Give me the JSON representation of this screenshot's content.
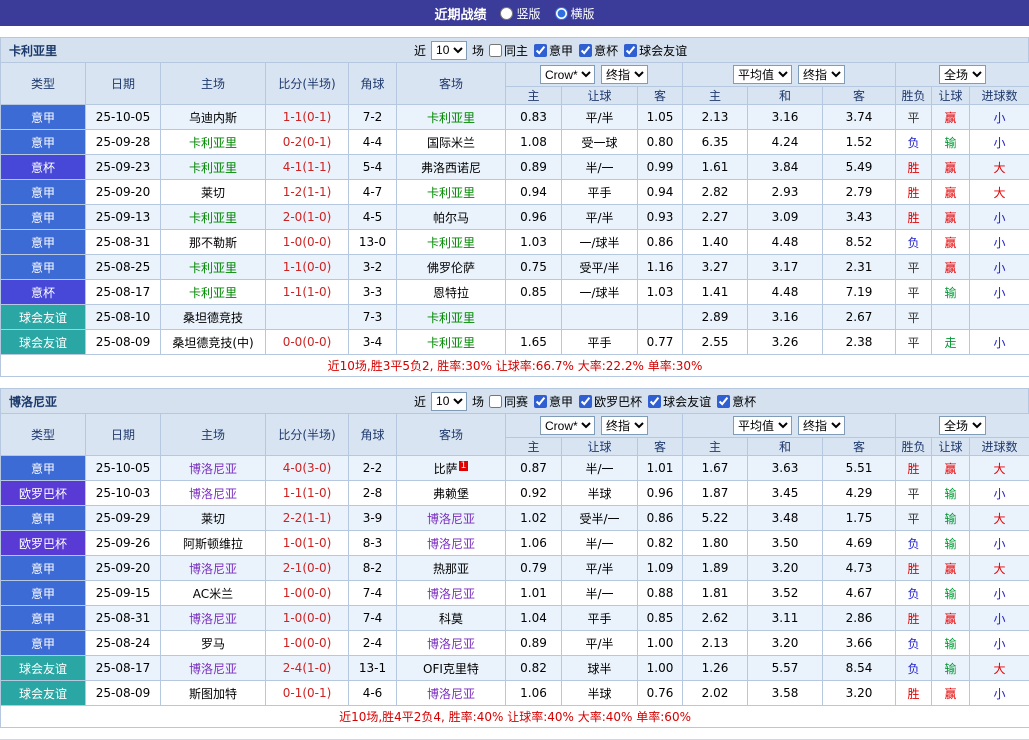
{
  "title_bar": {
    "title": "近期战绩",
    "radios": [
      {
        "label": "竖版",
        "selected": false
      },
      {
        "label": "横版",
        "selected": true
      }
    ]
  },
  "filter_labels": {
    "near": "近",
    "games": "场"
  },
  "columns": {
    "type": "类型",
    "date": "日期",
    "home": "主场",
    "score": "比分(半场)",
    "corner": "角球",
    "away": "客场",
    "asian_home": "主",
    "asian_line": "让球",
    "asian_away": "客",
    "euro_home": "主",
    "euro_draw": "和",
    "euro_away": "客",
    "result": "胜负",
    "handicap_result": "让球",
    "goals": "进球数"
  },
  "header_selects": {
    "odds_source": "Crow*",
    "odds_period": "终指",
    "euro_source": "平均值",
    "euro_period": "终指",
    "scope": "全场"
  },
  "colors": {
    "topbar_bg": "#3b3b99",
    "header_bg": "#d9e4f2",
    "row_alt_bg": "#eaf2fb",
    "score": "#cc2222",
    "summary": "#d40000"
  },
  "league_colors": {
    "意甲": "#3d6bd5",
    "意杯": "#4848d8",
    "球会友谊": "#2aa7a4",
    "欧罗巴杯": "#5a3ad5"
  },
  "result_colors": {
    "胜": "#e60000",
    "平": "#333333",
    "负": "#2222cc"
  },
  "let_colors": {
    "赢": "#e60000",
    "输": "#009933",
    "走": "#009933"
  },
  "goal_colors": {
    "大": "#e60000",
    "小": "#2222cc"
  },
  "sections": [
    {
      "team": "卡利亚里",
      "team_color": "#008800",
      "filter": {
        "count": "10",
        "checkboxes": [
          {
            "label": "同主",
            "checked": false
          },
          {
            "label": "意甲",
            "checked": true
          },
          {
            "label": "意杯",
            "checked": true
          },
          {
            "label": "球会友谊",
            "checked": true
          }
        ]
      },
      "rows": [
        {
          "league": "意甲",
          "date": "25-10-05",
          "home": "乌迪内斯",
          "home_focus": false,
          "score": "1-1(0-1)",
          "corner": "7-2",
          "away": "卡利亚里",
          "away_focus": true,
          "h": "0.83",
          "hcp": "平/半",
          "a": "1.05",
          "eh": "2.13",
          "ed": "3.16",
          "ea": "3.74",
          "res": "平",
          "let": "赢",
          "goal": "小"
        },
        {
          "league": "意甲",
          "date": "25-09-28",
          "home": "卡利亚里",
          "home_focus": true,
          "score": "0-2(0-1)",
          "corner": "4-4",
          "away": "国际米兰",
          "away_focus": false,
          "h": "1.08",
          "hcp": "受一球",
          "a": "0.80",
          "eh": "6.35",
          "ed": "4.24",
          "ea": "1.52",
          "res": "负",
          "let": "输",
          "goal": "小"
        },
        {
          "league": "意杯",
          "date": "25-09-23",
          "home": "卡利亚里",
          "home_focus": true,
          "score": "4-1(1-1)",
          "corner": "5-4",
          "away": "弗洛西诺尼",
          "away_focus": false,
          "h": "0.89",
          "hcp": "半/一",
          "a": "0.99",
          "eh": "1.61",
          "ed": "3.84",
          "ea": "5.49",
          "res": "胜",
          "let": "赢",
          "goal": "大"
        },
        {
          "league": "意甲",
          "date": "25-09-20",
          "home": "莱切",
          "home_focus": false,
          "score": "1-2(1-1)",
          "corner": "4-7",
          "away": "卡利亚里",
          "away_focus": true,
          "h": "0.94",
          "hcp": "平手",
          "a": "0.94",
          "eh": "2.82",
          "ed": "2.93",
          "ea": "2.79",
          "res": "胜",
          "let": "赢",
          "goal": "大"
        },
        {
          "league": "意甲",
          "date": "25-09-13",
          "home": "卡利亚里",
          "home_focus": true,
          "score": "2-0(1-0)",
          "corner": "4-5",
          "away": "帕尔马",
          "away_focus": false,
          "h": "0.96",
          "hcp": "平/半",
          "a": "0.93",
          "eh": "2.27",
          "ed": "3.09",
          "ea": "3.43",
          "res": "胜",
          "let": "赢",
          "goal": "小"
        },
        {
          "league": "意甲",
          "date": "25-08-31",
          "home": "那不勒斯",
          "home_focus": false,
          "score": "1-0(0-0)",
          "corner": "13-0",
          "away": "卡利亚里",
          "away_focus": true,
          "h": "1.03",
          "hcp": "一/球半",
          "a": "0.86",
          "eh": "1.40",
          "ed": "4.48",
          "ea": "8.52",
          "res": "负",
          "let": "赢",
          "goal": "小"
        },
        {
          "league": "意甲",
          "date": "25-08-25",
          "home": "卡利亚里",
          "home_focus": true,
          "score": "1-1(0-0)",
          "corner": "3-2",
          "away": "佛罗伦萨",
          "away_focus": false,
          "h": "0.75",
          "hcp": "受平/半",
          "a": "1.16",
          "eh": "3.27",
          "ed": "3.17",
          "ea": "2.31",
          "res": "平",
          "let": "赢",
          "goal": "小"
        },
        {
          "league": "意杯",
          "date": "25-08-17",
          "home": "卡利亚里",
          "home_focus": true,
          "score": "1-1(1-0)",
          "corner": "3-3",
          "away": "恩特拉",
          "away_focus": false,
          "h": "0.85",
          "hcp": "一/球半",
          "a": "1.03",
          "eh": "1.41",
          "ed": "4.48",
          "ea": "7.19",
          "res": "平",
          "let": "输",
          "goal": "小"
        },
        {
          "league": "球会友谊",
          "date": "25-08-10",
          "home": "桑坦德竞技",
          "home_focus": false,
          "score": "",
          "corner": "7-3",
          "away": "卡利亚里",
          "away_focus": true,
          "h": "",
          "hcp": "",
          "a": "",
          "eh": "2.89",
          "ed": "3.16",
          "ea": "2.67",
          "res": "平",
          "let": "",
          "goal": ""
        },
        {
          "league": "球会友谊",
          "date": "25-08-09",
          "home": "桑坦德竞技(中)",
          "home_focus": false,
          "score": "0-0(0-0)",
          "corner": "3-4",
          "away": "卡利亚里",
          "away_focus": true,
          "h": "1.65",
          "hcp": "平手",
          "a": "0.77",
          "eh": "2.55",
          "ed": "3.26",
          "ea": "2.38",
          "res": "平",
          "let": "走",
          "goal": "小"
        }
      ],
      "summary": "近10场,胜3平5负2, 胜率:30% 让球率:66.7% 大率:22.2% 单率:30%"
    },
    {
      "team": "博洛尼亚",
      "team_color": "#7b2fbe",
      "filter": {
        "count": "10",
        "checkboxes": [
          {
            "label": "同赛",
            "checked": false
          },
          {
            "label": "意甲",
            "checked": true
          },
          {
            "label": "欧罗巴杯",
            "checked": true
          },
          {
            "label": "球会友谊",
            "checked": true
          },
          {
            "label": "意杯",
            "checked": true
          }
        ]
      },
      "rows": [
        {
          "league": "意甲",
          "date": "25-10-05",
          "home": "博洛尼亚",
          "home_focus": true,
          "score": "4-0(3-0)",
          "corner": "2-2",
          "away": "比萨",
          "away_focus": false,
          "away_card": "1",
          "h": "0.87",
          "hcp": "半/一",
          "a": "1.01",
          "eh": "1.67",
          "ed": "3.63",
          "ea": "5.51",
          "res": "胜",
          "let": "赢",
          "goal": "大"
        },
        {
          "league": "欧罗巴杯",
          "date": "25-10-03",
          "home": "博洛尼亚",
          "home_focus": true,
          "score": "1-1(1-0)",
          "corner": "2-8",
          "away": "弗赖堡",
          "away_focus": false,
          "h": "0.92",
          "hcp": "半球",
          "a": "0.96",
          "eh": "1.87",
          "ed": "3.45",
          "ea": "4.29",
          "res": "平",
          "let": "输",
          "goal": "小"
        },
        {
          "league": "意甲",
          "date": "25-09-29",
          "home": "莱切",
          "home_focus": false,
          "score": "2-2(1-1)",
          "corner": "3-9",
          "away": "博洛尼亚",
          "away_focus": true,
          "h": "1.02",
          "hcp": "受半/一",
          "a": "0.86",
          "eh": "5.22",
          "ed": "3.48",
          "ea": "1.75",
          "res": "平",
          "let": "输",
          "goal": "大"
        },
        {
          "league": "欧罗巴杯",
          "date": "25-09-26",
          "home": "阿斯顿维拉",
          "home_focus": false,
          "score": "1-0(1-0)",
          "corner": "8-3",
          "away": "博洛尼亚",
          "away_focus": true,
          "h": "1.06",
          "hcp": "半/一",
          "a": "0.82",
          "eh": "1.80",
          "ed": "3.50",
          "ea": "4.69",
          "res": "负",
          "let": "输",
          "goal": "小"
        },
        {
          "league": "意甲",
          "date": "25-09-20",
          "home": "博洛尼亚",
          "home_focus": true,
          "score": "2-1(0-0)",
          "corner": "8-2",
          "away": "热那亚",
          "away_focus": false,
          "h": "0.79",
          "hcp": "平/半",
          "a": "1.09",
          "eh": "1.89",
          "ed": "3.20",
          "ea": "4.73",
          "res": "胜",
          "let": "赢",
          "goal": "大"
        },
        {
          "league": "意甲",
          "date": "25-09-15",
          "home": "AC米兰",
          "home_focus": false,
          "score": "1-0(0-0)",
          "corner": "7-4",
          "away": "博洛尼亚",
          "away_focus": true,
          "h": "1.01",
          "hcp": "半/一",
          "a": "0.88",
          "eh": "1.81",
          "ed": "3.52",
          "ea": "4.67",
          "res": "负",
          "let": "输",
          "goal": "小"
        },
        {
          "league": "意甲",
          "date": "25-08-31",
          "home": "博洛尼亚",
          "home_focus": true,
          "score": "1-0(0-0)",
          "corner": "7-4",
          "away": "科莫",
          "away_focus": false,
          "h": "1.04",
          "hcp": "平手",
          "a": "0.85",
          "eh": "2.62",
          "ed": "3.11",
          "ea": "2.86",
          "res": "胜",
          "let": "赢",
          "goal": "小"
        },
        {
          "league": "意甲",
          "date": "25-08-24",
          "home": "罗马",
          "home_focus": false,
          "score": "1-0(0-0)",
          "corner": "2-4",
          "away": "博洛尼亚",
          "away_focus": true,
          "h": "0.89",
          "hcp": "平/半",
          "a": "1.00",
          "eh": "2.13",
          "ed": "3.20",
          "ea": "3.66",
          "res": "负",
          "let": "输",
          "goal": "小"
        },
        {
          "league": "球会友谊",
          "date": "25-08-17",
          "home": "博洛尼亚",
          "home_focus": true,
          "score": "2-4(1-0)",
          "corner": "13-1",
          "away": "OFI克里特",
          "away_focus": false,
          "h": "0.82",
          "hcp": "球半",
          "a": "1.00",
          "eh": "1.26",
          "ed": "5.57",
          "ea": "8.54",
          "res": "负",
          "let": "输",
          "goal": "大"
        },
        {
          "league": "球会友谊",
          "date": "25-08-09",
          "home": "斯图加特",
          "home_focus": false,
          "score": "0-1(0-1)",
          "corner": "4-6",
          "away": "博洛尼亚",
          "away_focus": true,
          "h": "1.06",
          "hcp": "半球",
          "a": "0.76",
          "eh": "2.02",
          "ed": "3.58",
          "ea": "3.20",
          "res": "胜",
          "let": "赢",
          "goal": "小"
        }
      ],
      "summary": "近10场,胜4平2负4, 胜率:40% 让球率:40% 大率:40% 单率:60%"
    }
  ]
}
